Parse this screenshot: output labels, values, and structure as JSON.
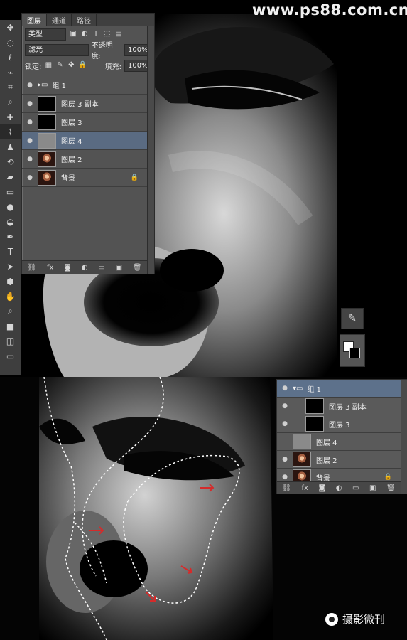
{
  "site": {
    "watermark": "www.ps88.com.cn",
    "bottom_logo": "摄影微刊"
  },
  "layers_panel": {
    "tabs": [
      "图层",
      "通道",
      "路径"
    ],
    "kind_label": "类型",
    "blend_mode": "滤光",
    "opacity_label": "不透明度:",
    "opacity_value": "100%",
    "lock_label": "锁定:",
    "fill_label": "填充:",
    "fill_value": "100%",
    "layers": [
      {
        "name": "组 1",
        "type": "group"
      },
      {
        "name": "图层 3 副本",
        "type": "black"
      },
      {
        "name": "图层 3",
        "type": "black"
      },
      {
        "name": "图层 4",
        "type": "gray"
      },
      {
        "name": "图层 2",
        "type": "face"
      },
      {
        "name": "背景",
        "type": "face_locked"
      }
    ],
    "bottom_icons": [
      "link-icon",
      "fx-icon",
      "mask-icon",
      "adjustment-icon",
      "folder-icon",
      "new-layer-icon",
      "trash-icon"
    ]
  },
  "toolbar": [
    "move",
    "marquee",
    "lasso",
    "quick-select",
    "crop",
    "eyedropper",
    "healing",
    "brush",
    "stamp",
    "history",
    "eraser",
    "gradient",
    "blur",
    "dodge",
    "pen",
    "type",
    "path-select",
    "shape",
    "hand",
    "zoom",
    "fg-bg",
    "mode",
    "screen"
  ],
  "colors": {
    "foreground": "#ffffff",
    "background": "#000000",
    "selected_layer": "#5a6b82"
  }
}
